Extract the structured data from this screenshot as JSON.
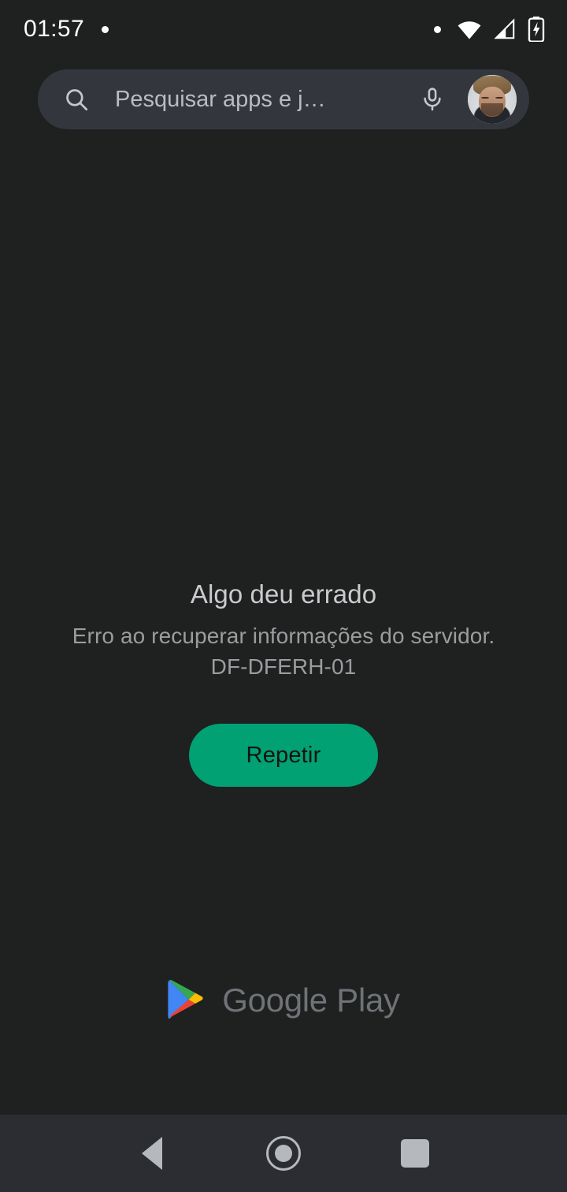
{
  "status_bar": {
    "time": "01:57",
    "notification_dot": "•",
    "right_dot": "•",
    "icons": [
      "notification-dot",
      "wifi-icon",
      "cellular-signal-icon",
      "battery-charging-icon"
    ]
  },
  "search": {
    "placeholder": "Pesquisar apps e j…",
    "value": "",
    "search_icon": "search-icon",
    "mic_icon": "microphone-icon",
    "avatar_label": "Conta do Google"
  },
  "error": {
    "title": "Algo deu errado",
    "description": "Erro ao recuperar informações do servidor.",
    "code": "DF-DFERH-01",
    "retry_label": "Repetir"
  },
  "brand": {
    "name": "Google Play",
    "logo": "google-play-logo",
    "logo_colors": {
      "blue": "#4285F4",
      "green": "#34A853",
      "yellow": "#FBBC04",
      "red": "#EA4335"
    }
  },
  "nav_bar": {
    "back_label": "Voltar",
    "home_label": "Início",
    "recents_label": "Recentes"
  },
  "theme": {
    "background": "#1F2020",
    "search_background": "#33373D",
    "nav_background": "#2B2D33",
    "accent_green": "#01A173",
    "title_text": "#C8CBCD",
    "secondary_text": "#9A9D9F",
    "brand_text": "#6F7377"
  }
}
